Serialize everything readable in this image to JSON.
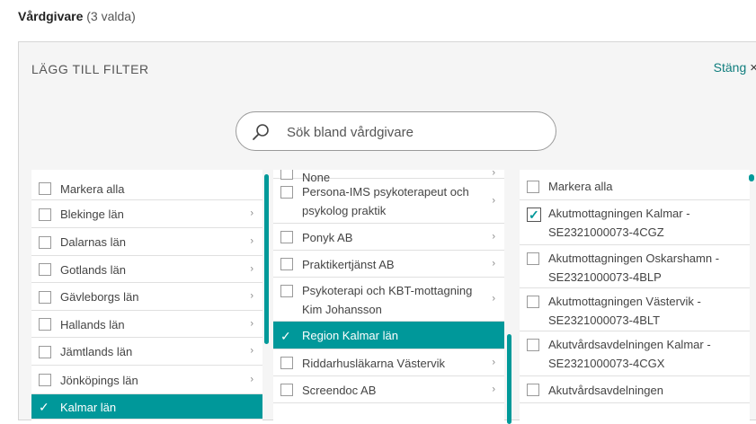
{
  "header": {
    "title": "Vårdgivare",
    "count": "(3 valda)"
  },
  "panel": {
    "title": "LÄGG TILL FILTER",
    "close_label": "Stäng",
    "close_icon": "×"
  },
  "search": {
    "placeholder": "Sök bland vårdgivare"
  },
  "colors": {
    "accent": "#00989a"
  },
  "column1": {
    "items": [
      {
        "label": "Markera alla",
        "checked": false,
        "chevron": false
      },
      {
        "label": "Blekinge län",
        "checked": false,
        "chevron": true
      },
      {
        "label": "Dalarnas län",
        "checked": false,
        "chevron": true
      },
      {
        "label": "Gotlands län",
        "checked": false,
        "chevron": true
      },
      {
        "label": "Gävleborgs län",
        "checked": false,
        "chevron": true
      },
      {
        "label": "Hallands län",
        "checked": false,
        "chevron": true
      },
      {
        "label": "Jämtlands län",
        "checked": false,
        "chevron": true
      },
      {
        "label": "Jönköpings län",
        "checked": false,
        "chevron": true
      },
      {
        "label": "Kalmar län",
        "checked": true,
        "chevron": false
      }
    ]
  },
  "column2": {
    "items": [
      {
        "label": "None",
        "checked": false,
        "chevron": true
      },
      {
        "label": "Persona-IMS psykoterapeut och psykolog praktik",
        "checked": false,
        "chevron": true
      },
      {
        "label": "Ponyk AB",
        "checked": false,
        "chevron": true
      },
      {
        "label": "Praktikertjänst AB",
        "checked": false,
        "chevron": true
      },
      {
        "label": "Psykoterapi och KBT-mottagning Kim Johansson",
        "checked": false,
        "chevron": true
      },
      {
        "label": "Region Kalmar län",
        "checked": true,
        "chevron": false
      },
      {
        "label": "Riddarhusläkarna Västervik",
        "checked": false,
        "chevron": true
      },
      {
        "label": "Screendoc AB",
        "checked": false,
        "chevron": true
      }
    ]
  },
  "column3": {
    "items": [
      {
        "label": "Markera alla",
        "checked": false,
        "chevron": false
      },
      {
        "label": "Akutmottagningen Kalmar - SE2321000073-4CGZ",
        "checked": true,
        "chevron": false
      },
      {
        "label": "Akutmottagningen Oskarshamn - SE2321000073-4BLP",
        "checked": false,
        "chevron": false
      },
      {
        "label": "Akutmottagningen Västervik - SE2321000073-4BLT",
        "checked": false,
        "chevron": false
      },
      {
        "label": "Akutvårdsavdelningen Kalmar - SE2321000073-4CGX",
        "checked": false,
        "chevron": false
      },
      {
        "label": "Akutvårdsavdelningen",
        "checked": false,
        "chevron": false
      }
    ]
  }
}
